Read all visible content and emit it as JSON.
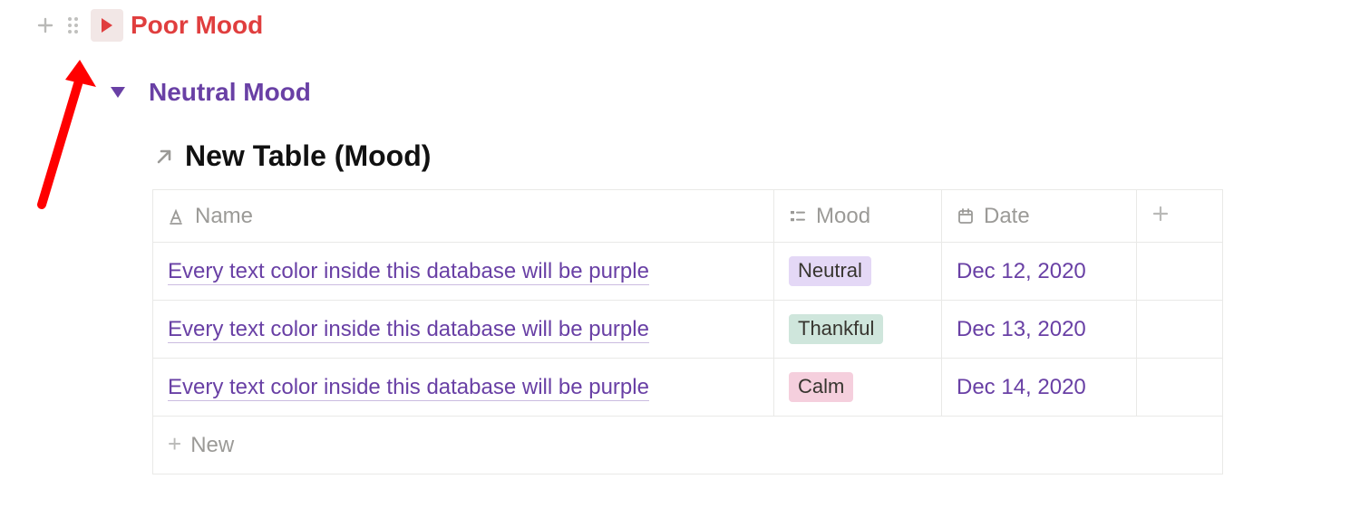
{
  "toggle_poor": {
    "label": "Poor Mood"
  },
  "toggle_neutral": {
    "label": "Neutral Mood"
  },
  "table": {
    "title": "New Table (Mood)",
    "columns": {
      "name": "Name",
      "mood": "Mood",
      "date": "Date"
    },
    "rows": [
      {
        "name": "Every text color inside this database will be purple",
        "mood": "Neutral",
        "mood_class": "tag-neutral",
        "date": "Dec 12, 2020"
      },
      {
        "name": "Every text color inside this database will be purple",
        "mood": "Thankful",
        "mood_class": "tag-thankful",
        "date": "Dec 13, 2020"
      },
      {
        "name": "Every text color inside this database will be purple",
        "mood": "Calm",
        "mood_class": "tag-calm",
        "date": "Dec 14, 2020"
      }
    ],
    "new_label": "New"
  },
  "colors": {
    "red": "#e03e3e",
    "purple": "#6940a5"
  }
}
